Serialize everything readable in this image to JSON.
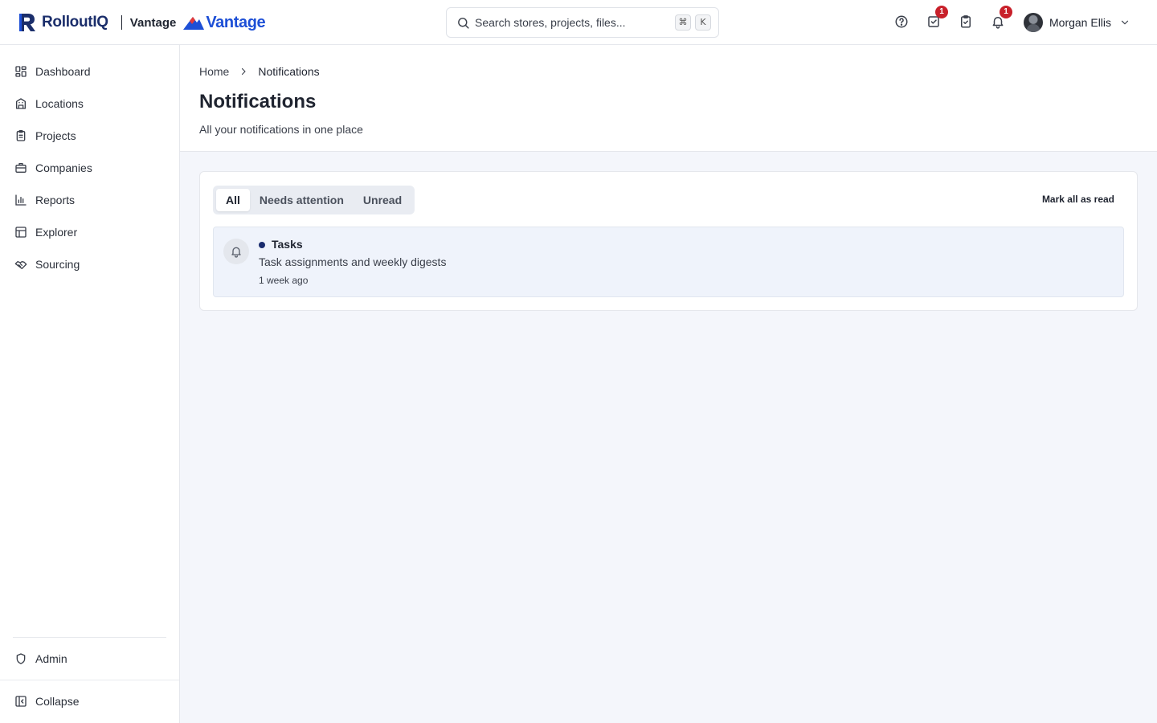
{
  "brand": {
    "name": "RolloutIQ",
    "sub": "Vantage",
    "product": "Vantage",
    "primary_color": "#1b2e6b",
    "accent_color": "#1d4fd6"
  },
  "search": {
    "placeholder": "Search stores, projects, files...",
    "value": "",
    "shortcut_keys": [
      "⌘",
      "K"
    ]
  },
  "topbar": {
    "icons": [
      {
        "name": "help-circle-icon"
      },
      {
        "name": "tasks-checkbox-icon",
        "badge": "1"
      },
      {
        "name": "clipboard-check-icon"
      },
      {
        "name": "bell-icon",
        "badge": "1"
      }
    ],
    "badge_color": "#c8202a"
  },
  "user": {
    "name": "Morgan Ellis",
    "menu_icon": "chevron-down-icon"
  },
  "sidebar": {
    "items": [
      {
        "label": "Dashboard",
        "icon": "dashboard-icon"
      },
      {
        "label": "Locations",
        "icon": "building-icon"
      },
      {
        "label": "Projects",
        "icon": "clipboard-icon"
      },
      {
        "label": "Companies",
        "icon": "briefcase-icon"
      },
      {
        "label": "Reports",
        "icon": "bar-chart-icon"
      },
      {
        "label": "Explorer",
        "icon": "table-icon"
      },
      {
        "label": "Sourcing",
        "icon": "handshake-icon"
      }
    ],
    "admin": {
      "label": "Admin",
      "icon": "shield-icon"
    },
    "collapse": {
      "label": "Collapse",
      "icon": "collapse-panel-icon"
    }
  },
  "breadcrumb": {
    "home": "Home",
    "current": "Notifications"
  },
  "page": {
    "title": "Notifications",
    "subtitle": "All your notifications in one place"
  },
  "tabs": {
    "items": [
      "All",
      "Needs attention",
      "Unread"
    ],
    "active": "All"
  },
  "actions": {
    "mark_all_read": "Mark all as read"
  },
  "notifications": [
    {
      "title": "Tasks",
      "description": "Task assignments and weekly digests",
      "time": "1 week ago",
      "unread": true,
      "icon": "bell-icon"
    }
  ]
}
